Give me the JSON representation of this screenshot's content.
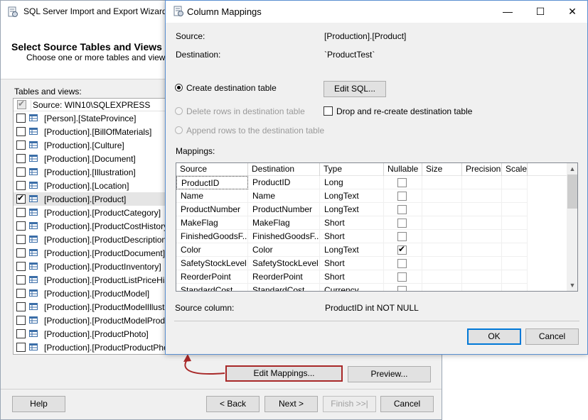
{
  "wizard": {
    "title": "SQL Server Import and Export Wizard",
    "page_title": "Select Source Tables and Views",
    "page_subtitle": "Choose one or more tables and views to",
    "tables_label": "Tables and views:",
    "list_header": "Source: WIN10\\SQLEXPRESS",
    "rows": [
      {
        "name": "[Person].[StateProvince]",
        "checked": false
      },
      {
        "name": "[Production].[BillOfMaterials]",
        "checked": false
      },
      {
        "name": "[Production].[Culture]",
        "checked": false
      },
      {
        "name": "[Production].[Document]",
        "checked": false
      },
      {
        "name": "[Production].[Illustration]",
        "checked": false
      },
      {
        "name": "[Production].[Location]",
        "checked": false
      },
      {
        "name": "[Production].[Product]",
        "checked": true
      },
      {
        "name": "[Production].[ProductCategory]",
        "checked": false
      },
      {
        "name": "[Production].[ProductCostHistory]",
        "checked": false
      },
      {
        "name": "[Production].[ProductDescription]",
        "checked": false
      },
      {
        "name": "[Production].[ProductDocument]",
        "checked": false
      },
      {
        "name": "[Production].[ProductInventory]",
        "checked": false
      },
      {
        "name": "[Production].[ProductListPriceHistory]",
        "checked": false
      },
      {
        "name": "[Production].[ProductModel]",
        "checked": false
      },
      {
        "name": "[Production].[ProductModelIllustration]",
        "checked": false
      },
      {
        "name": "[Production].[ProductModelProductD",
        "checked": false
      },
      {
        "name": "[Production].[ProductPhoto]",
        "checked": false
      },
      {
        "name": "[Production].[ProductProductPhoto]",
        "checked": false
      }
    ],
    "buttons": {
      "edit_mappings": "Edit Mappings...",
      "preview": "Preview...",
      "help": "Help",
      "back": "< Back",
      "next": "Next >",
      "finish": "Finish >>|",
      "cancel": "Cancel"
    }
  },
  "dialog": {
    "title": "Column Mappings",
    "source_label": "Source:",
    "source_value": "[Production].[Product]",
    "destination_label": "Destination:",
    "destination_value": "`ProductTest`",
    "radio_create": "Create destination table",
    "radio_delete": "Delete rows in destination table",
    "radio_append": "Append rows to the destination table",
    "edit_sql": "Edit SQL...",
    "drop_recreate": "Drop and re-create destination table",
    "mappings_label": "Mappings:",
    "columns": [
      "Source",
      "Destination",
      "Type",
      "Nullable",
      "Size",
      "Precision",
      "Scale"
    ],
    "rows": [
      {
        "source": "ProductID",
        "destination": "ProductID",
        "type": "Long",
        "nullable": false
      },
      {
        "source": "Name",
        "destination": "Name",
        "type": "LongText",
        "nullable": false
      },
      {
        "source": "ProductNumber",
        "destination": "ProductNumber",
        "type": "LongText",
        "nullable": false
      },
      {
        "source": "MakeFlag",
        "destination": "MakeFlag",
        "type": "Short",
        "nullable": false
      },
      {
        "source": "FinishedGoodsF...",
        "destination": "FinishedGoodsF...",
        "type": "Short",
        "nullable": false
      },
      {
        "source": "Color",
        "destination": "Color",
        "type": "LongText",
        "nullable": true
      },
      {
        "source": "SafetyStockLevel",
        "destination": "SafetyStockLevel",
        "type": "Short",
        "nullable": false
      },
      {
        "source": "ReorderPoint",
        "destination": "ReorderPoint",
        "type": "Short",
        "nullable": false
      },
      {
        "source": "StandardCost",
        "destination": "StandardCost",
        "type": "Currency",
        "nullable": false
      }
    ],
    "source_column_label": "Source column:",
    "source_column_value": "ProductID int NOT NULL",
    "ok": "OK",
    "cancel": "Cancel",
    "window_buttons": {
      "minimize": "—",
      "maximize": "☐",
      "close": "✕"
    }
  }
}
